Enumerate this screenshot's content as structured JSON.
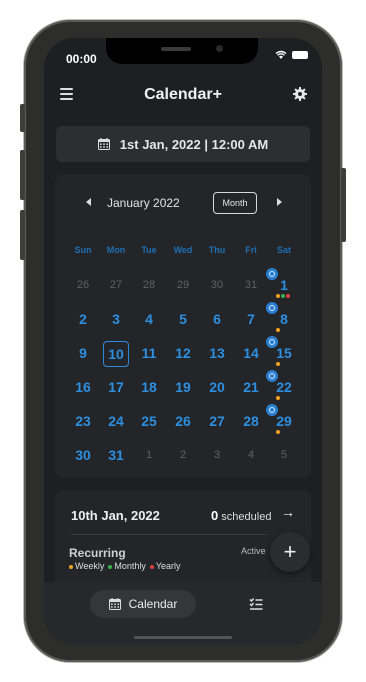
{
  "status": {
    "time": "00:00"
  },
  "app": {
    "title": "Calendar+"
  },
  "selected_datetime": "1st Jan, 2022 | 12:00 AM",
  "calendar": {
    "month_label": "January 2022",
    "view_button": "Month",
    "weekdays": [
      "Sun",
      "Mon",
      "Tue",
      "Wed",
      "Thu",
      "Fri",
      "Sat"
    ],
    "weeks": [
      [
        "26",
        "27",
        "28",
        "29",
        "30",
        "31",
        "1"
      ],
      [
        "2",
        "3",
        "4",
        "5",
        "6",
        "7",
        "8"
      ],
      [
        "9",
        "10",
        "11",
        "12",
        "13",
        "14",
        "15"
      ],
      [
        "16",
        "17",
        "18",
        "19",
        "20",
        "21",
        "22"
      ],
      [
        "23",
        "24",
        "25",
        "26",
        "27",
        "28",
        "29"
      ],
      [
        "30",
        "31",
        "1",
        "2",
        "3",
        "4",
        "5"
      ]
    ],
    "selected_day": "10"
  },
  "schedule": {
    "date": "10th Jan, 2022",
    "count": "0",
    "count_suffix": "scheduled",
    "section_title": "Recurring",
    "active_label": "Active",
    "legend": [
      {
        "label": "Weekly",
        "color": "#f0a020"
      },
      {
        "label": "Monthly",
        "color": "#38b24a"
      },
      {
        "label": "Yearly",
        "color": "#e04040"
      }
    ]
  },
  "nav": {
    "calendar_label": "Calendar"
  },
  "colors": {
    "accent": "#2d8fe0",
    "background": "#1d1f22",
    "card": "#232528"
  },
  "icons": {
    "menu": "menu-icon",
    "settings": "gear-icon",
    "calendar": "calendar-icon",
    "prev": "chevron-left-icon",
    "next": "chevron-right-icon",
    "repeat": "repeat-icon",
    "add": "plus-icon",
    "tasks": "checklist-icon"
  }
}
